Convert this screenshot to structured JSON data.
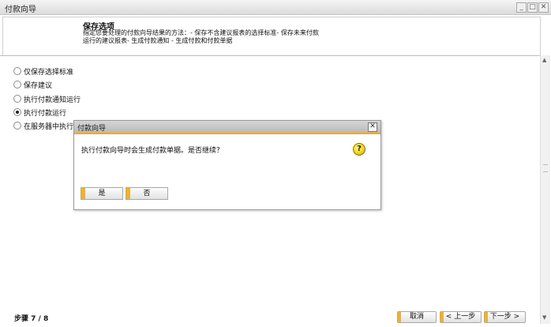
{
  "window": {
    "title": "付款向导",
    "min_label": "_",
    "max_label": "□",
    "close_label": "✕"
  },
  "header": {
    "title": "保存选项",
    "description": "指定您要处理的付款向导结果的方法：- 保存不含建议报表的选择标准- 保存未来付款运行的建议报表- 生成付款通知 - 生成付款和付款单据"
  },
  "options": [
    {
      "label": "仅保存选择标准",
      "selected": false
    },
    {
      "label": "保存建议",
      "selected": false
    },
    {
      "label": "执行付款通知运行",
      "selected": false
    },
    {
      "label": "执行付款运行",
      "selected": true
    },
    {
      "label": "在服务器中执行付",
      "selected": false
    }
  ],
  "dialog": {
    "title": "付款向导",
    "message": "执行付款向导时会生成付款单据。是否继续？",
    "close_label": "✕",
    "help_icon": "?",
    "yes_label": "是",
    "no_label": "否"
  },
  "footer": {
    "step_text": "步骤 7 / 8",
    "cancel_label": "取消",
    "back_label": "< 上一步",
    "next_label": "下一步 >"
  },
  "scrollbar": {
    "up": "▲",
    "down": "▼"
  },
  "colors": {
    "accent": "#f2b321",
    "dialog_title_underline": "#f0a917"
  }
}
